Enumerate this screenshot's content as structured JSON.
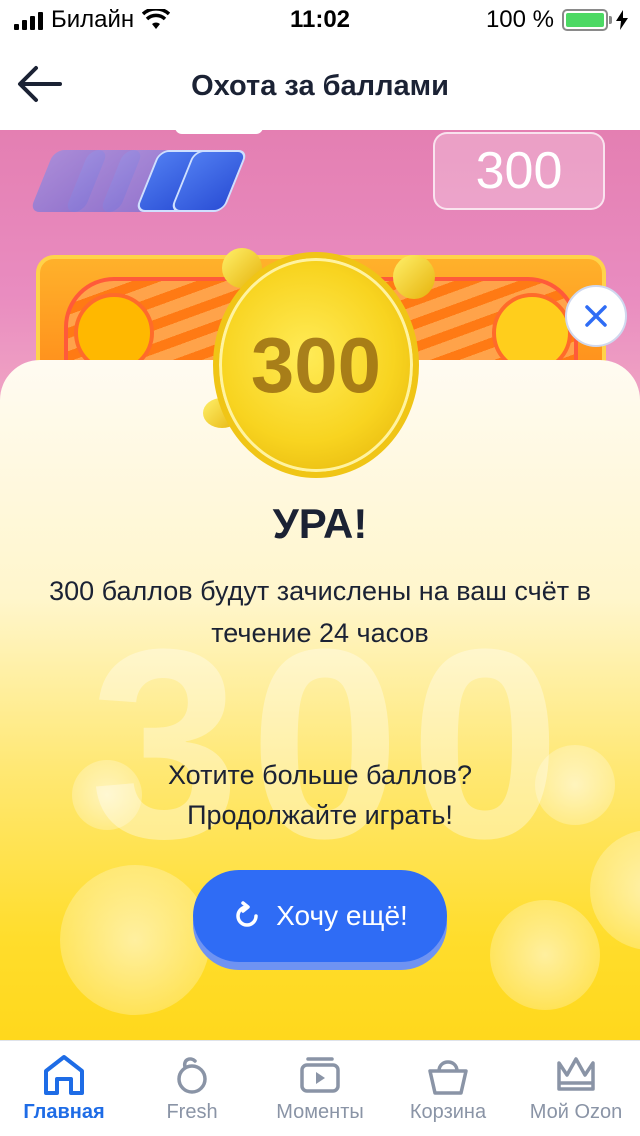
{
  "status_bar": {
    "carrier": "Билайн",
    "time": "11:02",
    "battery_percent": "100 %"
  },
  "header": {
    "title": "Охота за баллами"
  },
  "game": {
    "score": "300"
  },
  "coin": {
    "value": "300"
  },
  "sheet": {
    "title": "УРА!",
    "message": "300 баллов будут зачислены на ваш счёт в течение 24 часов",
    "cta_text_line1": "Хотите больше баллов?",
    "cta_text_line2": "Продолжайте играть!",
    "button_label": "Хочу ещё!"
  },
  "tabbar": {
    "items": [
      {
        "label": "Главная",
        "icon": "home-icon",
        "active": true
      },
      {
        "label": "Fresh",
        "icon": "fresh-icon",
        "active": false
      },
      {
        "label": "Моменты",
        "icon": "moments-icon",
        "active": false
      },
      {
        "label": "Корзина",
        "icon": "cart-icon",
        "active": false
      },
      {
        "label": "Мой Ozon",
        "icon": "crown-icon",
        "active": false
      }
    ]
  },
  "colors": {
    "accent": "#2f6cf5",
    "tab_active": "#1e6ce6",
    "coin": "#f8d420"
  }
}
